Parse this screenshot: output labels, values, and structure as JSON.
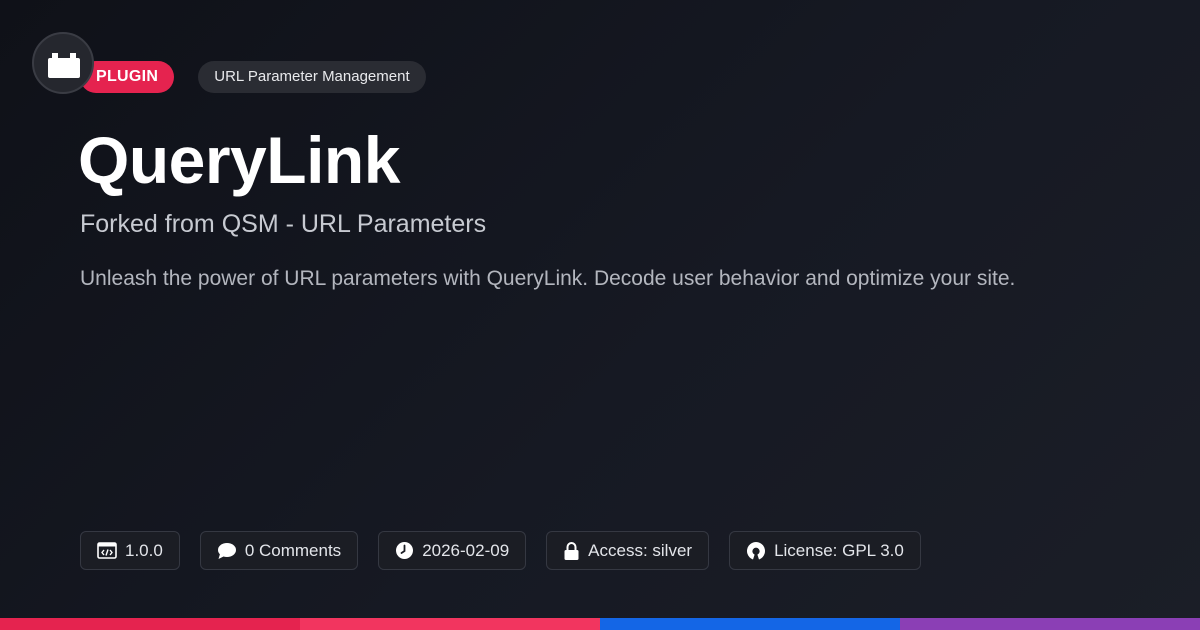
{
  "header": {
    "type_label": "PLUGIN",
    "category": "URL Parameter Management"
  },
  "title": "QueryLink",
  "subtitle": "Forked from QSM - URL Parameters",
  "description": "Unleash the power of URL parameters with QueryLink. Decode user behavior and optimize your site.",
  "meta": {
    "version": "1.0.0",
    "comments": "0 Comments",
    "date": "2026-02-09",
    "access": "Access: silver",
    "license": "License: GPL 3.0"
  },
  "icons": {
    "logo": "plugin-block-icon",
    "version": "code-window-icon",
    "comments": "speech-bubble-icon",
    "date": "clock-icon",
    "access": "lock-icon",
    "license": "open-source-icon"
  },
  "colors": {
    "accent": "#e5234f",
    "stripe": [
      "#e5234f",
      "#f2355f",
      "#1466e6",
      "#8b3fb5"
    ]
  }
}
